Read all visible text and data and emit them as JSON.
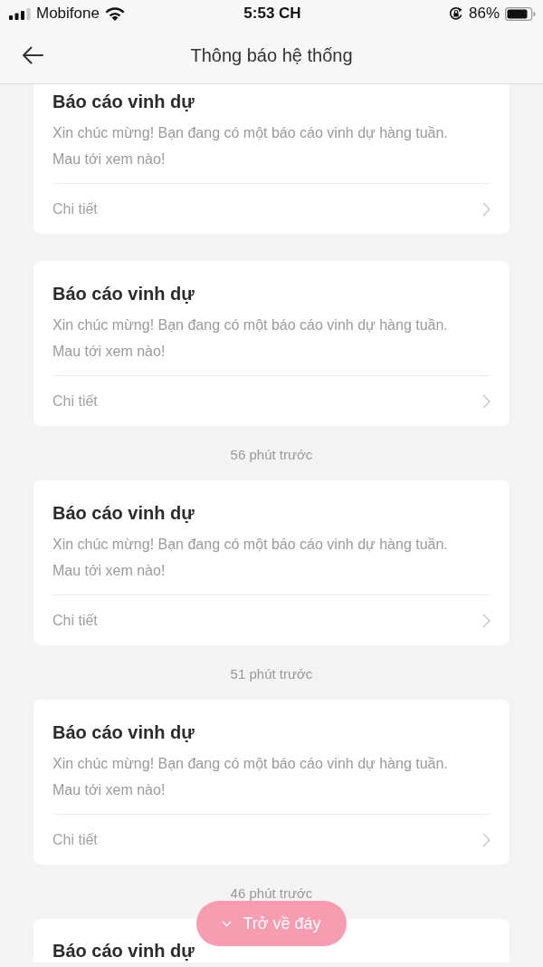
{
  "status_bar": {
    "carrier": "Mobifone",
    "time": "5:53 CH",
    "battery": "86%"
  },
  "header": {
    "title": "Thông báo hệ thống"
  },
  "feed": [
    {
      "kind": "card",
      "title": "Báo cáo vinh dự",
      "message": "Xin chúc mừng! Bạn đang có một báo cáo vinh dự hàng tuần.\nMau tới xem nào!",
      "link": "Chi tiết"
    },
    {
      "kind": "card",
      "title": "Báo cáo vinh dự",
      "message": "Xin chúc mừng! Bạn đang có một báo cáo vinh dự hàng tuần.\nMau tới xem nào!",
      "link": "Chi tiết"
    },
    {
      "kind": "timestamp",
      "text": "56 phút trước"
    },
    {
      "kind": "card",
      "title": "Báo cáo vinh dự",
      "message": "Xin chúc mừng! Bạn đang có một báo cáo vinh dự hàng tuần.\nMau tới xem nào!",
      "link": "Chi tiết"
    },
    {
      "kind": "timestamp",
      "text": "51 phút trước"
    },
    {
      "kind": "card",
      "title": "Báo cáo vinh dự",
      "message": "Xin chúc mừng! Bạn đang có một báo cáo vinh dự hàng tuần.\nMau tới xem nào!",
      "link": "Chi tiết"
    },
    {
      "kind": "timestamp",
      "text": "46 phút trước"
    },
    {
      "kind": "card",
      "title": "Báo cáo vinh dự"
    }
  ],
  "floating_button": {
    "label": "Trở về đáy"
  }
}
